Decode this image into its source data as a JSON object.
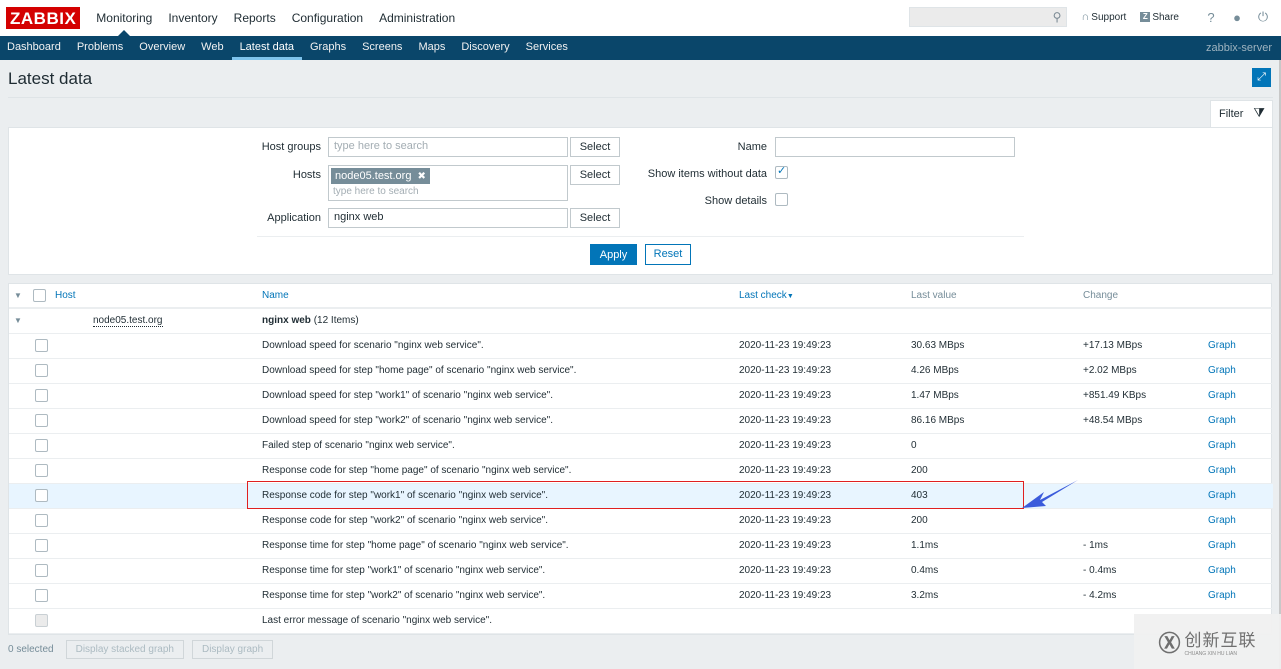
{
  "header": {
    "logo": "ZABBIX",
    "main_menu": [
      "Monitoring",
      "Inventory",
      "Reports",
      "Configuration",
      "Administration"
    ],
    "active_main": "Monitoring",
    "search_placeholder": "",
    "support_label": "Support",
    "share_label": "Share",
    "share_badge": "Z",
    "help_icon": "?",
    "user_icon": "user-icon",
    "logout_icon": "power-icon"
  },
  "subnav": {
    "items": [
      "Dashboard",
      "Problems",
      "Overview",
      "Web",
      "Latest data",
      "Graphs",
      "Screens",
      "Maps",
      "Discovery",
      "Services"
    ],
    "active": "Latest data",
    "server_name": "zabbix-server"
  },
  "page": {
    "title": "Latest data",
    "fullscreen_icon": "⤢"
  },
  "filter": {
    "tab_label": "Filter",
    "host_groups_label": "Host groups",
    "host_groups_placeholder": "type here to search",
    "hosts_label": "Hosts",
    "hosts_selected": [
      "node05.test.org"
    ],
    "hosts_placeholder": "type here to search",
    "application_label": "Application",
    "application_value": "nginx web",
    "select_label": "Select",
    "name_label": "Name",
    "name_value": "",
    "show_items_without_data_label": "Show items without data",
    "show_items_without_data": true,
    "show_details_label": "Show details",
    "show_details": false,
    "apply_label": "Apply",
    "reset_label": "Reset"
  },
  "table": {
    "columns": {
      "host": "Host",
      "name": "Name",
      "last_check": "Last check",
      "last_value": "Last value",
      "change": "Change"
    },
    "group": {
      "host": "node05.test.org",
      "app_name": "nginx web",
      "app_count": "(12 Items)"
    },
    "graph_label": "Graph",
    "rows": [
      {
        "name": "Download speed for scenario \"nginx web service\".",
        "last_check": "2020-11-23 19:49:23",
        "last_value": "30.63 MBps",
        "change": "+17.13 MBps",
        "graph": "Graph"
      },
      {
        "name": "Download speed for step \"home page\" of scenario \"nginx web service\".",
        "last_check": "2020-11-23 19:49:23",
        "last_value": "4.26 MBps",
        "change": "+2.02 MBps",
        "graph": "Graph"
      },
      {
        "name": "Download speed for step \"work1\" of scenario \"nginx web service\".",
        "last_check": "2020-11-23 19:49:23",
        "last_value": "1.47 MBps",
        "change": "+851.49 KBps",
        "graph": "Graph"
      },
      {
        "name": "Download speed for step \"work2\" of scenario \"nginx web service\".",
        "last_check": "2020-11-23 19:49:23",
        "last_value": "86.16 MBps",
        "change": "+48.54 MBps",
        "graph": "Graph"
      },
      {
        "name": "Failed step of scenario \"nginx web service\".",
        "last_check": "2020-11-23 19:49:23",
        "last_value": "0",
        "change": "",
        "graph": "Graph"
      },
      {
        "name": "Response code for step \"home page\" of scenario \"nginx web service\".",
        "last_check": "2020-11-23 19:49:23",
        "last_value": "200",
        "change": "",
        "graph": "Graph"
      },
      {
        "name": "Response code for step \"work1\" of scenario \"nginx web service\".",
        "last_check": "2020-11-23 19:49:23",
        "last_value": "403",
        "change": "",
        "graph": "Graph"
      },
      {
        "name": "Response code for step \"work2\" of scenario \"nginx web service\".",
        "last_check": "2020-11-23 19:49:23",
        "last_value": "200",
        "change": "",
        "graph": "Graph"
      },
      {
        "name": "Response time for step \"home page\" of scenario \"nginx web service\".",
        "last_check": "2020-11-23 19:49:23",
        "last_value": "1.1ms",
        "change": "- 1ms",
        "graph": "Graph"
      },
      {
        "name": "Response time for step \"work1\" of scenario \"nginx web service\".",
        "last_check": "2020-11-23 19:49:23",
        "last_value": "0.4ms",
        "change": "- 0.4ms",
        "graph": "Graph"
      },
      {
        "name": "Response time for step \"work2\" of scenario \"nginx web service\".",
        "last_check": "2020-11-23 19:49:23",
        "last_value": "3.2ms",
        "change": "- 4.2ms",
        "graph": "Graph"
      },
      {
        "name": "Last error message of scenario \"nginx web service\".",
        "last_check": "",
        "last_value": "",
        "change": "",
        "graph": ""
      }
    ]
  },
  "footer": {
    "selected": "0 selected",
    "stacked_graph_label": "Display stacked graph",
    "graph_label": "Display graph"
  },
  "watermark": {
    "cn": "创新互联",
    "en": "CHUANG XIN HU LIAN"
  },
  "colors": {
    "brand_red": "#d40000",
    "nav_blue": "#0a466a",
    "link_blue": "#0275b8",
    "highlight_row": "#e8f5ff",
    "annotation_red": "#e02020",
    "annotation_arrow": "#3b5bdb"
  }
}
